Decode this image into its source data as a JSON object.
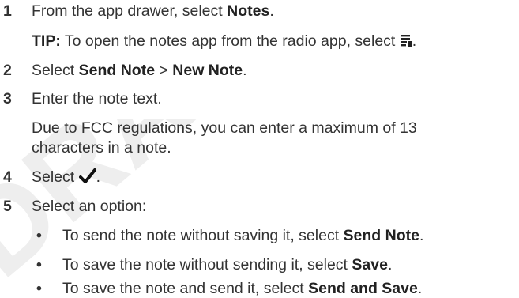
{
  "steps": [
    {
      "num": "1",
      "pre": "From the app drawer, select ",
      "bold": "Notes",
      "post": "."
    },
    {
      "tip_label": "TIP:",
      "tip_text": " To open the notes app from the radio app, select ",
      "tip_icon": "notes-app-icon",
      "tip_post": "."
    },
    {
      "num": "2",
      "pre": "Select ",
      "bold1": "Send Note",
      "mid": " > ",
      "bold2": "New Note",
      "post": "."
    },
    {
      "num": "3",
      "text": "Enter the note text."
    },
    {
      "note_line1": "Due to FCC regulations, you can enter a maximum of 13",
      "note_line2": "characters in a note."
    },
    {
      "num": "4",
      "pre": "Select ",
      "icon": "checkmark-icon",
      "post": "."
    },
    {
      "num": "5",
      "text": "Select an option:"
    }
  ],
  "options": [
    {
      "bullet": "•",
      "pre": "To send the note without saving it, select ",
      "bold": "Send Note",
      "post": "."
    },
    {
      "bullet": "•",
      "pre": "To save the note without sending it, select ",
      "bold": "Save",
      "post": "."
    },
    {
      "bullet": "•",
      "pre": "To save the note and send it, select ",
      "bold": "Send and Save",
      "post": "."
    }
  ],
  "watermark": {
    "text": "DRAFT",
    "color": "#dddddd"
  }
}
